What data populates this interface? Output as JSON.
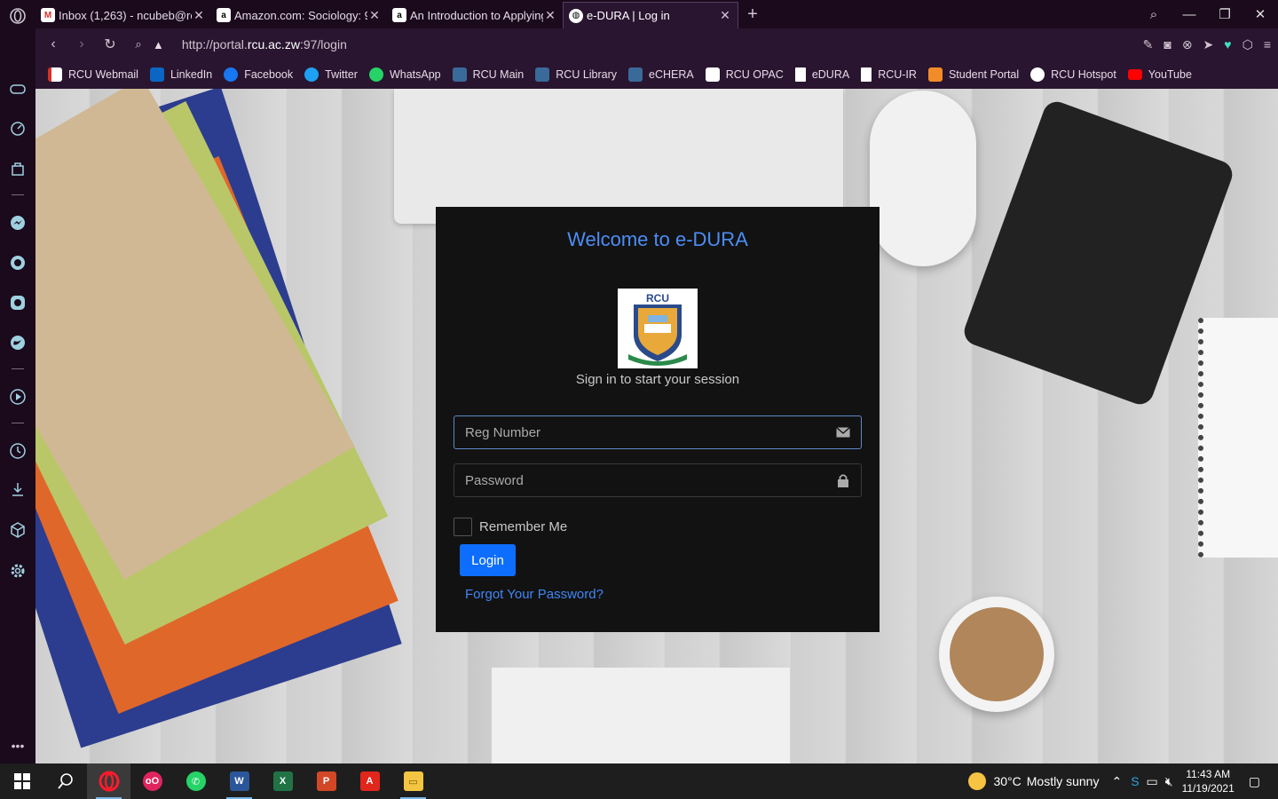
{
  "browser": {
    "tabs": [
      {
        "label": "Inbox (1,263) - ncubeb@rc",
        "icon": "gmail-icon",
        "active": false
      },
      {
        "label": "Amazon.com: Sociology: 9",
        "icon": "amazon-icon",
        "active": false
      },
      {
        "label": "An Introduction to Applying",
        "icon": "amazon-icon",
        "active": false
      },
      {
        "label": "e-DURA | Log in",
        "icon": "globe-icon",
        "active": true
      }
    ],
    "url_prefix": "http://portal.",
    "url_host": "rcu.ac.zw",
    "url_suffix": ":97/login",
    "bookmarks": [
      {
        "label": "RCU Webmail",
        "icon": "gmail-icon",
        "color": "#d93025"
      },
      {
        "label": "LinkedIn",
        "icon": "linkedin-icon",
        "color": "#0a66c2"
      },
      {
        "label": "Facebook",
        "icon": "facebook-icon",
        "color": "#1877f2"
      },
      {
        "label": "Twitter",
        "icon": "twitter-icon",
        "color": "#1da1f2"
      },
      {
        "label": "WhatsApp",
        "icon": "whatsapp-icon",
        "color": "#25d366"
      },
      {
        "label": "RCU Main",
        "icon": "rcu-icon",
        "color": "#3a6a9a"
      },
      {
        "label": "RCU Library",
        "icon": "rcu-icon",
        "color": "#3a6a9a"
      },
      {
        "label": "eCHERA",
        "icon": "rcu-icon",
        "color": "#3a6a9a"
      },
      {
        "label": "RCU OPAC",
        "icon": "koha-icon",
        "color": "#ffffff"
      },
      {
        "label": "eDURA",
        "icon": "page-icon",
        "color": "#ffffff"
      },
      {
        "label": "RCU-IR",
        "icon": "page-icon",
        "color": "#ffffff"
      },
      {
        "label": "Student Portal",
        "icon": "portal-icon",
        "color": "#f28c28"
      },
      {
        "label": "RCU Hotspot",
        "icon": "hotspot-icon",
        "color": "#ffffff"
      },
      {
        "label": "YouTube",
        "icon": "youtube-icon",
        "color": "#ff0000"
      }
    ]
  },
  "login": {
    "title": "Welcome to e-DURA",
    "logo_text": "RCU",
    "subtitle": "Sign in to start your session",
    "reg_placeholder": "Reg Number",
    "password_placeholder": "Password",
    "remember_label": "Remember Me",
    "login_label": "Login",
    "forgot_label": "Forgot Your Password?",
    "accent": "#4c8df6",
    "button_color": "#0d6efd"
  },
  "taskbar": {
    "weather_temp": "30°C",
    "weather_text": "Mostly sunny",
    "time": "11:43 AM",
    "date": "11/19/2021"
  }
}
